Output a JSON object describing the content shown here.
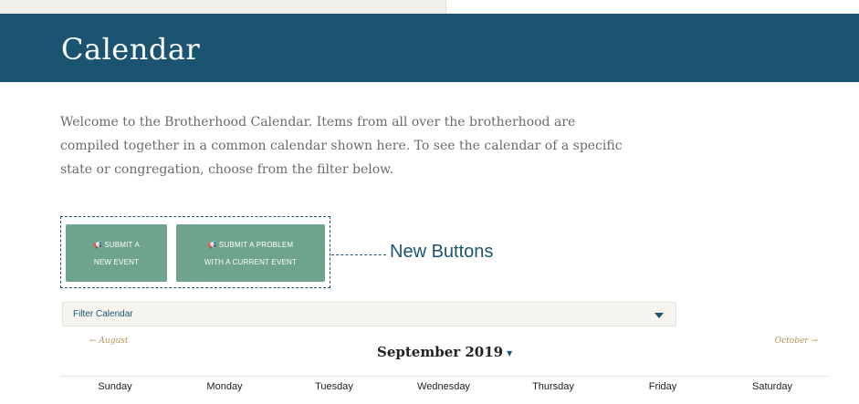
{
  "header": {
    "title": "Calendar"
  },
  "intro": {
    "text": "Welcome to the Brotherhood Calendar. Items from all over the brotherhood are compiled together in a common calendar shown here. To see the calendar of a specific state or congregation, choose from the filter below."
  },
  "buttons": {
    "submit_new": {
      "line1": "SUBMIT A",
      "line2": "NEW EVENT",
      "icon": "megaphone-icon"
    },
    "submit_problem": {
      "line1": "SUBMIT A PROBLEM",
      "line2": "WITH A CURRENT EVENT",
      "icon": "megaphone-icon"
    }
  },
  "annotation": {
    "label": "New Buttons"
  },
  "filter": {
    "label": "Filter Calendar"
  },
  "calendar": {
    "prev_month": "← August",
    "next_month": "October →",
    "current_month": "September 2019",
    "weekdays": [
      "Sunday",
      "Monday",
      "Tuesday",
      "Wednesday",
      "Thursday",
      "Friday",
      "Saturday"
    ]
  },
  "colors": {
    "banner": "#1b5470",
    "button": "#6ea48c",
    "nav_link": "#b88f57",
    "annotation": "#1b5470"
  }
}
